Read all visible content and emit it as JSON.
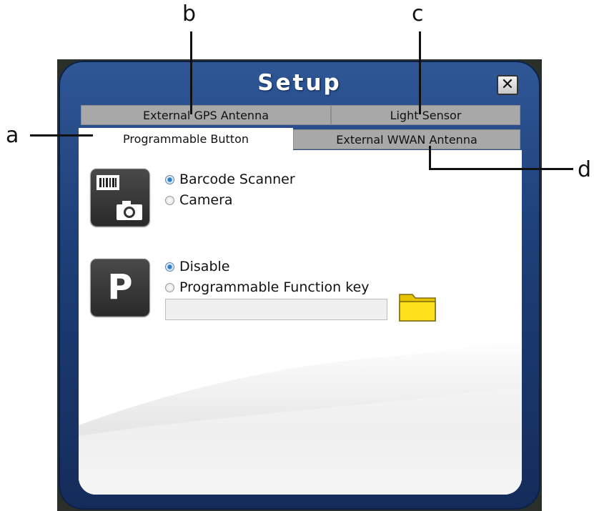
{
  "window": {
    "title": "Setup",
    "close_label": "✕"
  },
  "tabs": {
    "row1": [
      {
        "label": "External GPS Antenna"
      },
      {
        "label": "Light Sensor"
      }
    ],
    "row2": [
      {
        "label": "Programmable Button",
        "active": true
      },
      {
        "label": "External WWAN Antenna"
      }
    ]
  },
  "scan_section": {
    "icon": "barcode-camera-icon",
    "options": [
      {
        "label": "Barcode Scanner",
        "checked": true
      },
      {
        "label": "Camera",
        "checked": false
      }
    ]
  },
  "key_section": {
    "icon_letter": "P",
    "options": [
      {
        "label": "Disable",
        "checked": true
      },
      {
        "label": "Programmable Function key",
        "checked": false
      }
    ],
    "input_value": "",
    "folder_icon": "folder-icon"
  },
  "callouts": {
    "a": "a",
    "b": "b",
    "c": "c",
    "d": "d"
  },
  "colors": {
    "frame": "#1e3f78",
    "tab_inactive": "#a8a8a8",
    "folder": "#f5d800"
  }
}
